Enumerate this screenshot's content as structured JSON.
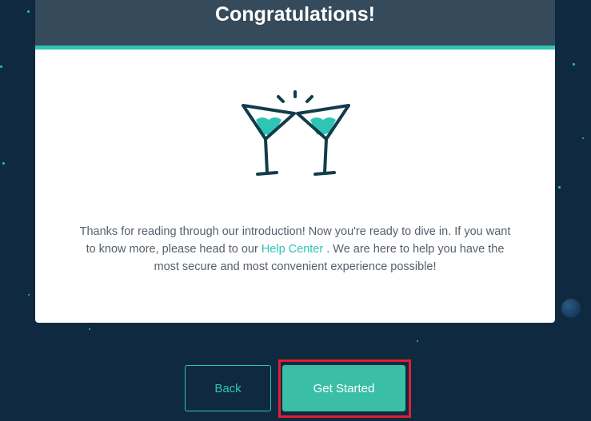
{
  "title": "Congratulations!",
  "message": {
    "before": "Thanks for reading through our introduction! Now you're ready to dive in. If you want to know more, please head to our ",
    "link": "Help Center",
    "after": " . We are here to help you have the most secure and most convenient experience possible!"
  },
  "buttons": {
    "back": "Back",
    "get_started": "Get Started"
  },
  "illustration": {
    "icon": "cocktail-glasses-toast-icon"
  },
  "colors": {
    "background": "#0f2a40",
    "header": "#354a5a",
    "accent": "#2ec4b6",
    "primary_button": "#3abfa6",
    "highlight": "#e0202e"
  }
}
